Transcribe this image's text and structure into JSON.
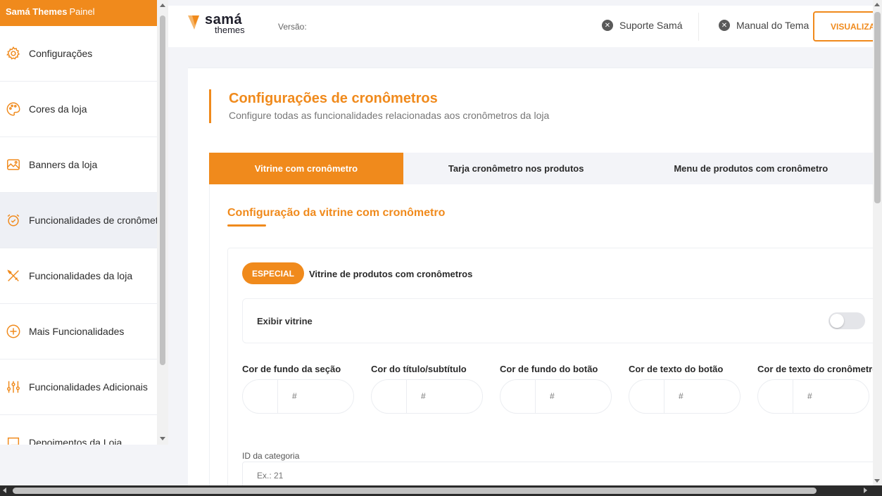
{
  "sidebar": {
    "brand": "Samá Themes",
    "brand_sub": "Painel",
    "items": [
      {
        "label": "Configurações",
        "icon": "gear-icon"
      },
      {
        "label": "Cores da loja",
        "icon": "palette-icon"
      },
      {
        "label": "Banners da loja",
        "icon": "image-icon"
      },
      {
        "label": "Funcionalidades de cronômetro",
        "icon": "alarm-clock-icon"
      },
      {
        "label": "Funcionalidades da loja",
        "icon": "tools-icon"
      },
      {
        "label": "Mais Funcionalidades",
        "icon": "plus-circle-icon"
      },
      {
        "label": "Funcionalidades Adicionais",
        "icon": "sliders-icon"
      },
      {
        "label": "Depoimentos da Loja",
        "icon": "chat-icon"
      }
    ]
  },
  "topbar": {
    "logo_line1": "samá",
    "logo_line2": "themes",
    "version_label": "Versão:",
    "support_link": "Suporte Samá",
    "manual_link": "Manual do Tema",
    "preview_button": "VISUALIZAR"
  },
  "main": {
    "title": "Configurações de cronômetros",
    "subtitle": "Configure todas as funcionalidades relacionadas aos cronômetros da loja",
    "tabs": [
      {
        "label": "Vitrine com cronômetro",
        "active": true
      },
      {
        "label": "Tarja cronômetro nos produtos",
        "active": false
      },
      {
        "label": "Menu de produtos com cronômetro",
        "active": false
      }
    ],
    "section_title": "Configuração da vitrine com cronômetro",
    "badge": "ESPECIAL",
    "badge_label": "Vitrine de produtos com cronômetros",
    "exibir_label": "Exibir vitrine",
    "exibir_enabled": false,
    "color_fields": [
      {
        "label": "Cor de fundo da seção",
        "placeholder": "#"
      },
      {
        "label": "Cor do título/subtítulo",
        "placeholder": "#"
      },
      {
        "label": "Cor de fundo do botão",
        "placeholder": "#"
      },
      {
        "label": "Cor de texto do botão",
        "placeholder": "#"
      },
      {
        "label": "Cor de texto do cronômetro",
        "placeholder": "#"
      }
    ],
    "category_label": "ID da categoria",
    "category_placeholder": "Ex.: 21"
  },
  "colors": {
    "accent": "#f08a1c",
    "sidebar_active": "#eef0f5",
    "page_bg": "#f3f4f8"
  }
}
